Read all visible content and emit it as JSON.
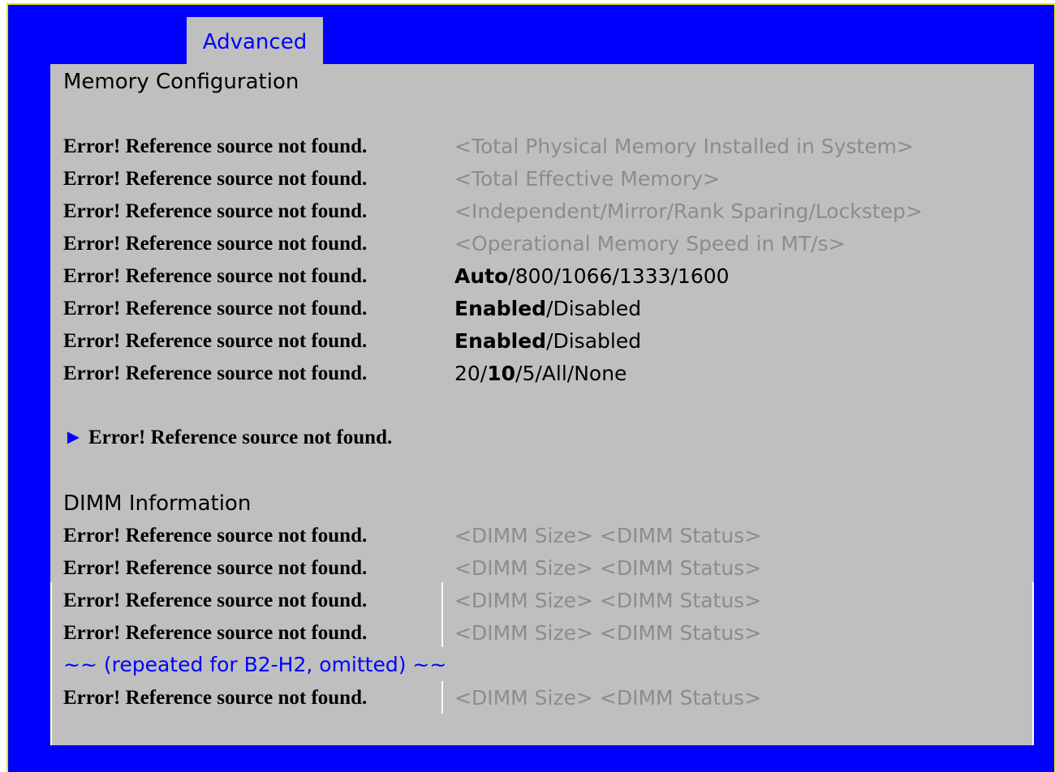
{
  "tab": {
    "label": "Advanced"
  },
  "panel_title": "Memory Configuration",
  "memory_rows": [
    {
      "label": "Error! Reference source not found.",
      "value": "<Total Physical Memory Installed in System>"
    },
    {
      "label": "Error! Reference source not found.",
      "value": "<Total Effective Memory>"
    },
    {
      "label": "Error! Reference source not found.",
      "value": "<Independent/Mirror/Rank Sparing/Lockstep>"
    },
    {
      "label": "Error! Reference source not found.",
      "value": "<Operational Memory Speed in MT/s>"
    },
    {
      "label": "Error! Reference source not found.",
      "selected": "Auto",
      "rest": "/800/1066/1333/1600"
    },
    {
      "label": "Error! Reference source not found.",
      "selected": "Enabled",
      "rest": "/Disabled"
    },
    {
      "label": "Error! Reference source not found.",
      "selected": "Enabled",
      "rest": "/Disabled"
    },
    {
      "label": "Error! Reference source not found.",
      "pre": "20/",
      "selected": "10",
      "rest": "/5/All/None"
    }
  ],
  "submenu": {
    "arrow": "►",
    "label": "Error! Reference source not found."
  },
  "dimm_section_title": "DIMM Information",
  "dimm_rows": [
    {
      "label": "Error! Reference source not found.",
      "value": "<DIMM Size> <DIMM Status>"
    },
    {
      "label": "Error! Reference source not found.",
      "value": "<DIMM Size> <DIMM Status>"
    },
    {
      "label": "Error! Reference source not found.",
      "value": "<DIMM Size> <DIMM Status>"
    },
    {
      "label": "Error! Reference source not found.",
      "value": "<DIMM Size> <DIMM Status>"
    }
  ],
  "omitted_note": "~~ (repeated for B2-H2, omitted) ~~",
  "last_dimm_row": {
    "label": "Error! Reference source not found.",
    "value": "<DIMM Size> <DIMM Status>"
  },
  "colors": {
    "frame": "#0000ff",
    "panel": "#bfbfbf",
    "accent_text": "#0000ff",
    "readonly_text": "#8c8c8c"
  }
}
